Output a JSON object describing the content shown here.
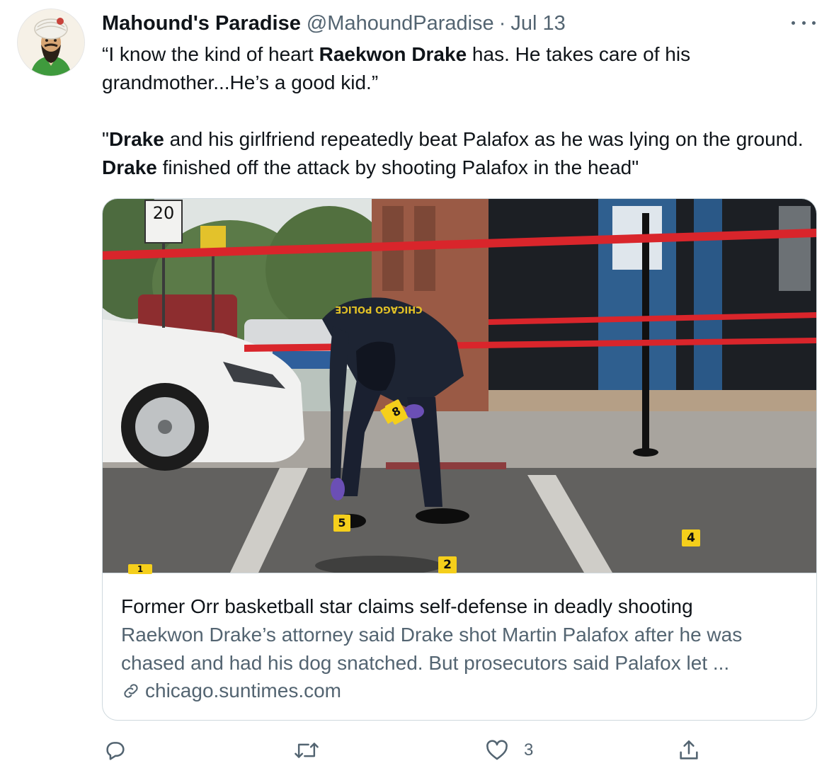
{
  "tweet": {
    "author_name": "Mahound's Paradise",
    "author_handle": "@MahoundParadise",
    "separator": "·",
    "date": "Jul 13",
    "text": {
      "p1_a": "“I know the kind of heart ",
      "p1_b": "Raekwon Drake",
      "p1_c": " has. He takes care of his grandmother...He’s a good kid.”",
      "p2_a": "\"",
      "p2_b": "Drake",
      "p2_c": " and his girlfriend repeatedly beat Palafox as he was lying on the ground. ",
      "p2_d": "Drake",
      "p2_e": " finished off the attack by shooting Palafox in the head\""
    }
  },
  "card": {
    "title": "Former Orr basketball star claims self-defense in deadly shooting",
    "description": "Raekwon Drake’s attorney said Drake shot Martin Palafox after he was chased and had his dog snatched. But prosecutors said Palafox let ...",
    "domain": "chicago.suntimes.com",
    "image": {
      "speed_sign": "20",
      "jacket_text": "CHICAGO POLICE",
      "evidence_markers": [
        "1",
        "2",
        "4",
        "5",
        "8"
      ]
    }
  },
  "actions": {
    "reply_count": "",
    "retweet_count": "",
    "like_count": "3"
  },
  "icons": {
    "more": "more-dots-icon",
    "reply": "reply-icon",
    "retweet": "retweet-icon",
    "like": "heart-icon",
    "share": "share-icon",
    "link": "link-icon"
  },
  "colors": {
    "text": "#0f1419",
    "secondary": "#536471",
    "border": "#cfd9de",
    "police_tape": "#d9252b",
    "evidence_marker": "#f5cf1b"
  }
}
